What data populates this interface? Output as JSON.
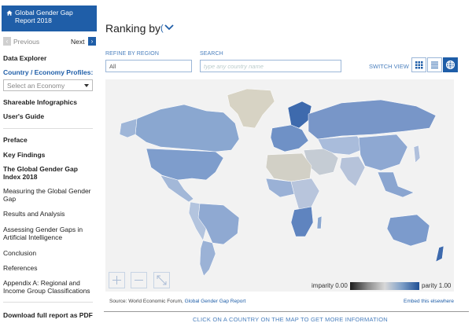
{
  "sidebar": {
    "report_title": "Global Gender Gap Report 2018",
    "prev_label": "Previous",
    "next_label": "Next",
    "data_explorer": "Data Explorer",
    "profiles_label": "Country / Economy Profiles:",
    "economy_select": "Select an Economy",
    "infographics": "Shareable Infographics",
    "users_guide": "User's Guide",
    "preface": "Preface",
    "key_findings": "Key Findings",
    "index_title": "The Global Gender Gap Index 2018",
    "items": [
      "Measuring the Global Gender Gap",
      "Results and Analysis",
      "Assessing Gender Gaps in Artificial Intelligence",
      "Conclusion",
      "References",
      "Appendix A: Regional and Income Group Classifications"
    ],
    "download": "Download full report as PDF"
  },
  "main": {
    "ranking_title": "Ranking by",
    "refine_label": "REFINE BY REGION",
    "region_value": "All",
    "search_label": "SEARCH",
    "search_placeholder": "type any country name",
    "switch_view": "SWITCH VIEW",
    "legend_left": "imparity 0.00",
    "legend_right": "parity 1.00",
    "source_prefix": "Source: World Economic Forum,",
    "source_link": "Global Gender Gap Report",
    "embed": "Embed this elsewhere",
    "cta": "CLICK ON A COUNTRY ON THE MAP TO GET MORE INFORMATION"
  },
  "colors": {
    "brand": "#1f5ea8",
    "map_bg": "#f2f2f2",
    "parity_high": "#1f4f93",
    "parity_low": "#1c1c1c",
    "no_data": "#d9d2c0"
  },
  "icons": [
    "home-icon",
    "chevron-left-icon",
    "chevron-right-icon",
    "chevron-down-icon",
    "grid-view-icon",
    "list-view-icon",
    "globe-icon",
    "zoom-in-icon",
    "zoom-out-icon",
    "expand-icon"
  ]
}
